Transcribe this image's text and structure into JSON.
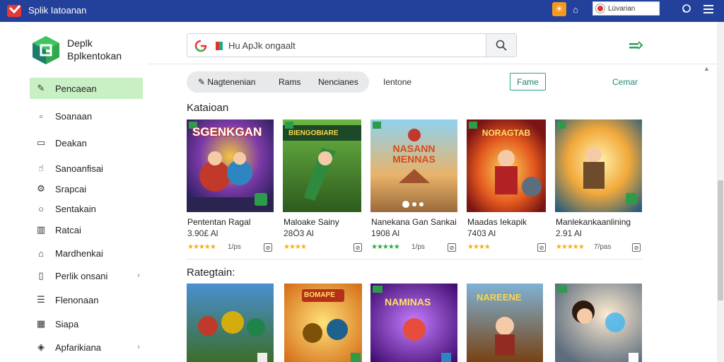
{
  "titlebar": {
    "title": "Splik Iatoanan",
    "search_text": "Lüvarian"
  },
  "sidebar": {
    "brand_line1": "Deplk",
    "brand_line2": "Bplkentokan",
    "items": [
      {
        "label": "Pencaean",
        "icon": "pencil-icon",
        "active": true
      },
      {
        "label": "Soanaan",
        "icon": "square-icon"
      },
      {
        "label": "Deakan",
        "icon": "book-icon"
      },
      {
        "label": "Sanoanfisai",
        "icon": "hand-icon"
      },
      {
        "label": "Srapcai",
        "icon": "gear-icon"
      },
      {
        "label": "Sentakain",
        "icon": "circle-icon"
      },
      {
        "label": "Ratcai",
        "icon": "chart-icon"
      },
      {
        "label": "Mardhenkai",
        "icon": "home-icon"
      },
      {
        "label": "Perlik onsani",
        "icon": "folder-icon",
        "chevron": true
      },
      {
        "label": "Flenonaan",
        "icon": "list-icon"
      },
      {
        "label": "Siapa",
        "icon": "table-icon"
      },
      {
        "label": "Apfarikiana",
        "icon": "bag-icon",
        "chevron": true
      }
    ]
  },
  "search": {
    "placeholder": "Hu ApJk ongaalt"
  },
  "tabs": {
    "items": [
      "Nagtenenian",
      "Rams",
      "Nencianes"
    ],
    "plain": "Ientone",
    "button": "Fame",
    "link": "Cemar"
  },
  "section1": {
    "title": "Kataioan",
    "cards": [
      {
        "title": "Pententan Ragal",
        "count": "3.90£ Al",
        "rating": "1/ps",
        "banner": "SGENKGAN",
        "stars": "gold"
      },
      {
        "title": "Maloake Sainy",
        "count": "28Ö3 Al",
        "rating": "",
        "banner": "BIENGOBIARE",
        "stars": "gold"
      },
      {
        "title": "Nanekana Gan Sankai",
        "count": "1908 Al",
        "rating": "1/ps",
        "banner": "NASANN MENNAS",
        "stars": "green"
      },
      {
        "title": "Maadas Iekapik",
        "count": "7403 Al",
        "rating": "",
        "banner": "NORAGTAB",
        "stars": "gold"
      },
      {
        "title": "Manlekankaanlining",
        "count": "2.91 Al",
        "rating": "7/pas",
        "banner": "",
        "stars": "gold"
      }
    ]
  },
  "section2": {
    "title": "Rategtain:",
    "cards": [
      {
        "banner": ""
      },
      {
        "banner": "BOMAPE"
      },
      {
        "banner": "NAMINAS"
      },
      {
        "banner": "NAREENE"
      },
      {
        "banner": ""
      }
    ]
  }
}
